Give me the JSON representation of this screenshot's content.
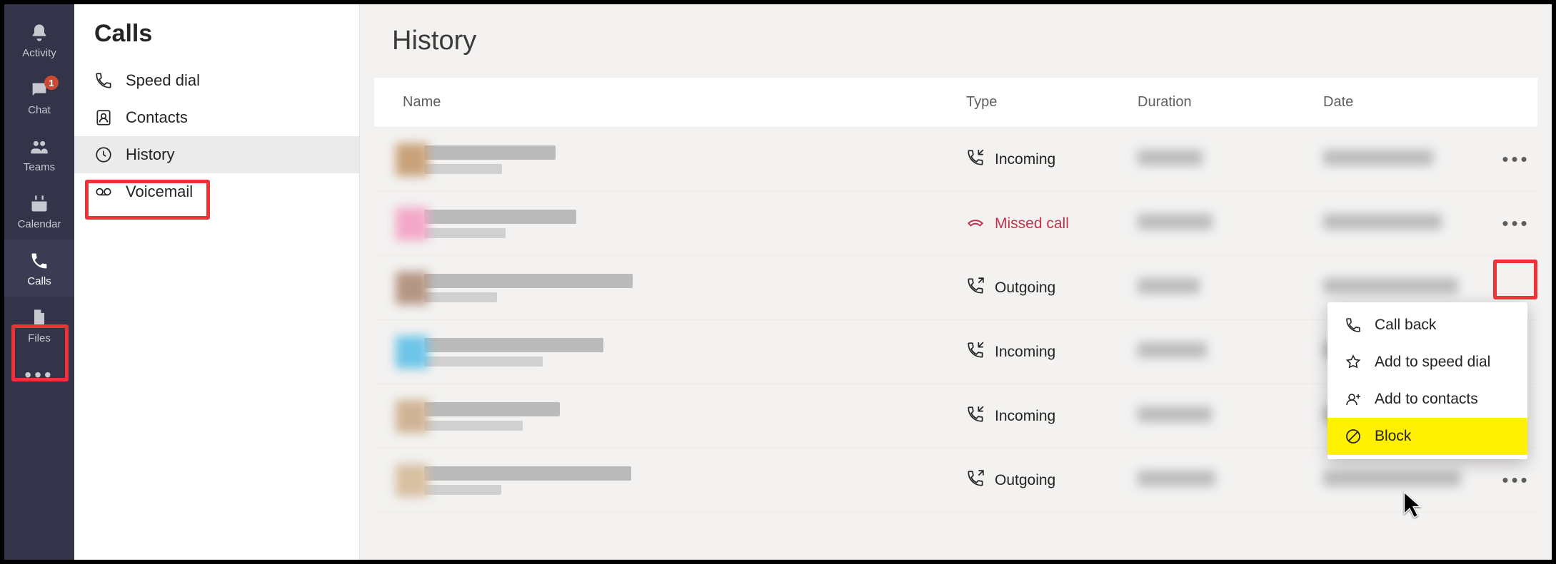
{
  "rail": {
    "items": [
      {
        "key": "activity",
        "label": "Activity"
      },
      {
        "key": "chat",
        "label": "Chat",
        "badge": "1"
      },
      {
        "key": "teams",
        "label": "Teams"
      },
      {
        "key": "calendar",
        "label": "Calendar"
      },
      {
        "key": "calls",
        "label": "Calls",
        "selected": true
      },
      {
        "key": "files",
        "label": "Files"
      }
    ]
  },
  "callsPanel": {
    "title": "Calls",
    "items": [
      {
        "key": "speed",
        "label": "Speed dial"
      },
      {
        "key": "contacts",
        "label": "Contacts"
      },
      {
        "key": "history",
        "label": "History",
        "selected": true
      },
      {
        "key": "voicemail",
        "label": "Voicemail"
      }
    ]
  },
  "history": {
    "title": "History",
    "columns": {
      "name": "Name",
      "type": "Type",
      "duration": "Duration",
      "date": "Date"
    },
    "rows": [
      {
        "avatar": "#c9a27a",
        "type": "Incoming",
        "typeColor": "#252423",
        "showMore": true
      },
      {
        "avatar": "#f3a8c8",
        "type": "Missed call",
        "typeColor": "#c4314b",
        "showMore": true,
        "moreHighlighted": true
      },
      {
        "avatar": "#b59684",
        "type": "Outgoing",
        "typeColor": "#252423",
        "showMore": false
      },
      {
        "avatar": "#6dc5e8",
        "type": "Incoming",
        "typeColor": "#252423",
        "showMore": false
      },
      {
        "avatar": "#d0b394",
        "type": "Incoming",
        "typeColor": "#252423",
        "showMore": false
      },
      {
        "avatar": "#d7bfa0",
        "type": "Outgoing",
        "typeColor": "#252423",
        "showMore": true
      }
    ]
  },
  "contextMenu": {
    "items": [
      {
        "key": "callback",
        "label": "Call back"
      },
      {
        "key": "speed",
        "label": "Add to speed dial"
      },
      {
        "key": "contacts",
        "label": "Add to contacts"
      },
      {
        "key": "block",
        "label": "Block",
        "highlighted": true
      }
    ]
  }
}
